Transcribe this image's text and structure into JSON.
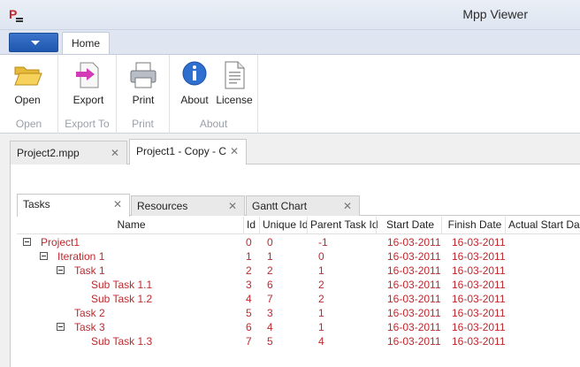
{
  "window": {
    "title": "Mpp Viewer"
  },
  "ribbon": {
    "tabs": [
      "Home"
    ],
    "groups": [
      {
        "label": "Open",
        "buttons": [
          {
            "label": "Open",
            "icon": "folder-open-icon"
          }
        ]
      },
      {
        "label": "Export To",
        "buttons": [
          {
            "label": "Export",
            "icon": "export-icon"
          }
        ]
      },
      {
        "label": "Print",
        "buttons": [
          {
            "label": "Print",
            "icon": "printer-icon"
          }
        ]
      },
      {
        "label": "About",
        "buttons": [
          {
            "label": "About",
            "icon": "info-icon"
          },
          {
            "label": "License",
            "icon": "document-icon"
          }
        ]
      }
    ]
  },
  "documents": {
    "tabs": [
      {
        "label": "Project2.mpp",
        "active": false
      },
      {
        "label": "Project1 - Copy - C",
        "active": true
      }
    ]
  },
  "view_tabs": [
    {
      "label": "Tasks",
      "active": true
    },
    {
      "label": "Resources",
      "active": false
    },
    {
      "label": "Gantt Chart",
      "active": false
    }
  ],
  "grid": {
    "columns": [
      "Name",
      "Id",
      "Unique Id",
      "Parent Task Id",
      "Start Date",
      "Finish Date",
      "Actual Start Da"
    ],
    "rows": [
      {
        "level": 0,
        "expandable": true,
        "name": "Project1",
        "id": "0",
        "unique_id": "0",
        "parent": "-1",
        "start": "16-03-2011",
        "finish": "16-03-2011"
      },
      {
        "level": 1,
        "expandable": true,
        "name": "Iteration 1",
        "id": "1",
        "unique_id": "1",
        "parent": "0",
        "start": "16-03-2011",
        "finish": "16-03-2011"
      },
      {
        "level": 2,
        "expandable": true,
        "name": "Task 1",
        "id": "2",
        "unique_id": "2",
        "parent": "1",
        "start": "16-03-2011",
        "finish": "16-03-2011"
      },
      {
        "level": 3,
        "expandable": false,
        "name": "Sub Task 1.1",
        "id": "3",
        "unique_id": "6",
        "parent": "2",
        "start": "16-03-2011",
        "finish": "16-03-2011"
      },
      {
        "level": 3,
        "expandable": false,
        "name": "Sub Task 1.2",
        "id": "4",
        "unique_id": "7",
        "parent": "2",
        "start": "16-03-2011",
        "finish": "16-03-2011"
      },
      {
        "level": 2,
        "expandable": false,
        "name": "Task 2",
        "id": "5",
        "unique_id": "3",
        "parent": "1",
        "start": "16-03-2011",
        "finish": "16-03-2011"
      },
      {
        "level": 2,
        "expandable": true,
        "name": "Task 3",
        "id": "6",
        "unique_id": "4",
        "parent": "1",
        "start": "16-03-2011",
        "finish": "16-03-2011"
      },
      {
        "level": 3,
        "expandable": false,
        "name": "Sub Task 1.3",
        "id": "7",
        "unique_id": "5",
        "parent": "4",
        "start": "16-03-2011",
        "finish": "16-03-2011"
      }
    ]
  },
  "colors": {
    "task_text": "#c0282c",
    "accent": "#2b63c0"
  }
}
